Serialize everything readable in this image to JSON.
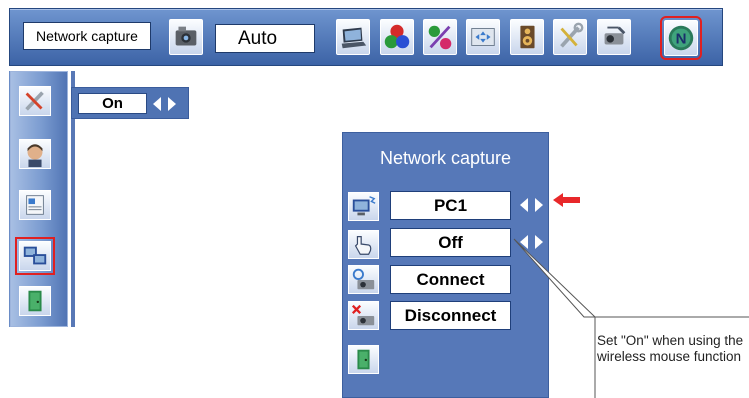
{
  "topbar": {
    "label": "Network capture",
    "value": "Auto",
    "icons": [
      "camera-icon",
      "laptop-icon",
      "color-balls-icon",
      "color-adjust-icon",
      "screen-icon",
      "speaker-icon",
      "wrench-icon",
      "projector-icon",
      "network-n-icon"
    ],
    "selected_icon": "network-n-icon"
  },
  "sidebar": {
    "icons": [
      "wrench-icon",
      "person-head-icon",
      "document-icon",
      "network-capture-icon",
      "exit-door-icon"
    ],
    "selected_icon": "network-capture-icon"
  },
  "setting": {
    "value": "On"
  },
  "panel": {
    "title": "Network capture",
    "rows": [
      {
        "icon": "monitor-icon",
        "value": "PC1",
        "has_arrows": true
      },
      {
        "icon": "hand-pointer-icon",
        "value": "Off",
        "has_arrows": true
      },
      {
        "icon": "connect-icon",
        "value": "Connect",
        "has_arrows": false
      },
      {
        "icon": "disconnect-icon",
        "value": "Disconnect",
        "has_arrows": false
      }
    ],
    "exit_icon": "exit-door-icon"
  },
  "callout": {
    "text": "Set \"On\" when using the wireless mouse function"
  },
  "colors": {
    "menu_blue": "#5678b8",
    "highlight_red": "#e02020",
    "pointer_red": "#e8282a"
  }
}
